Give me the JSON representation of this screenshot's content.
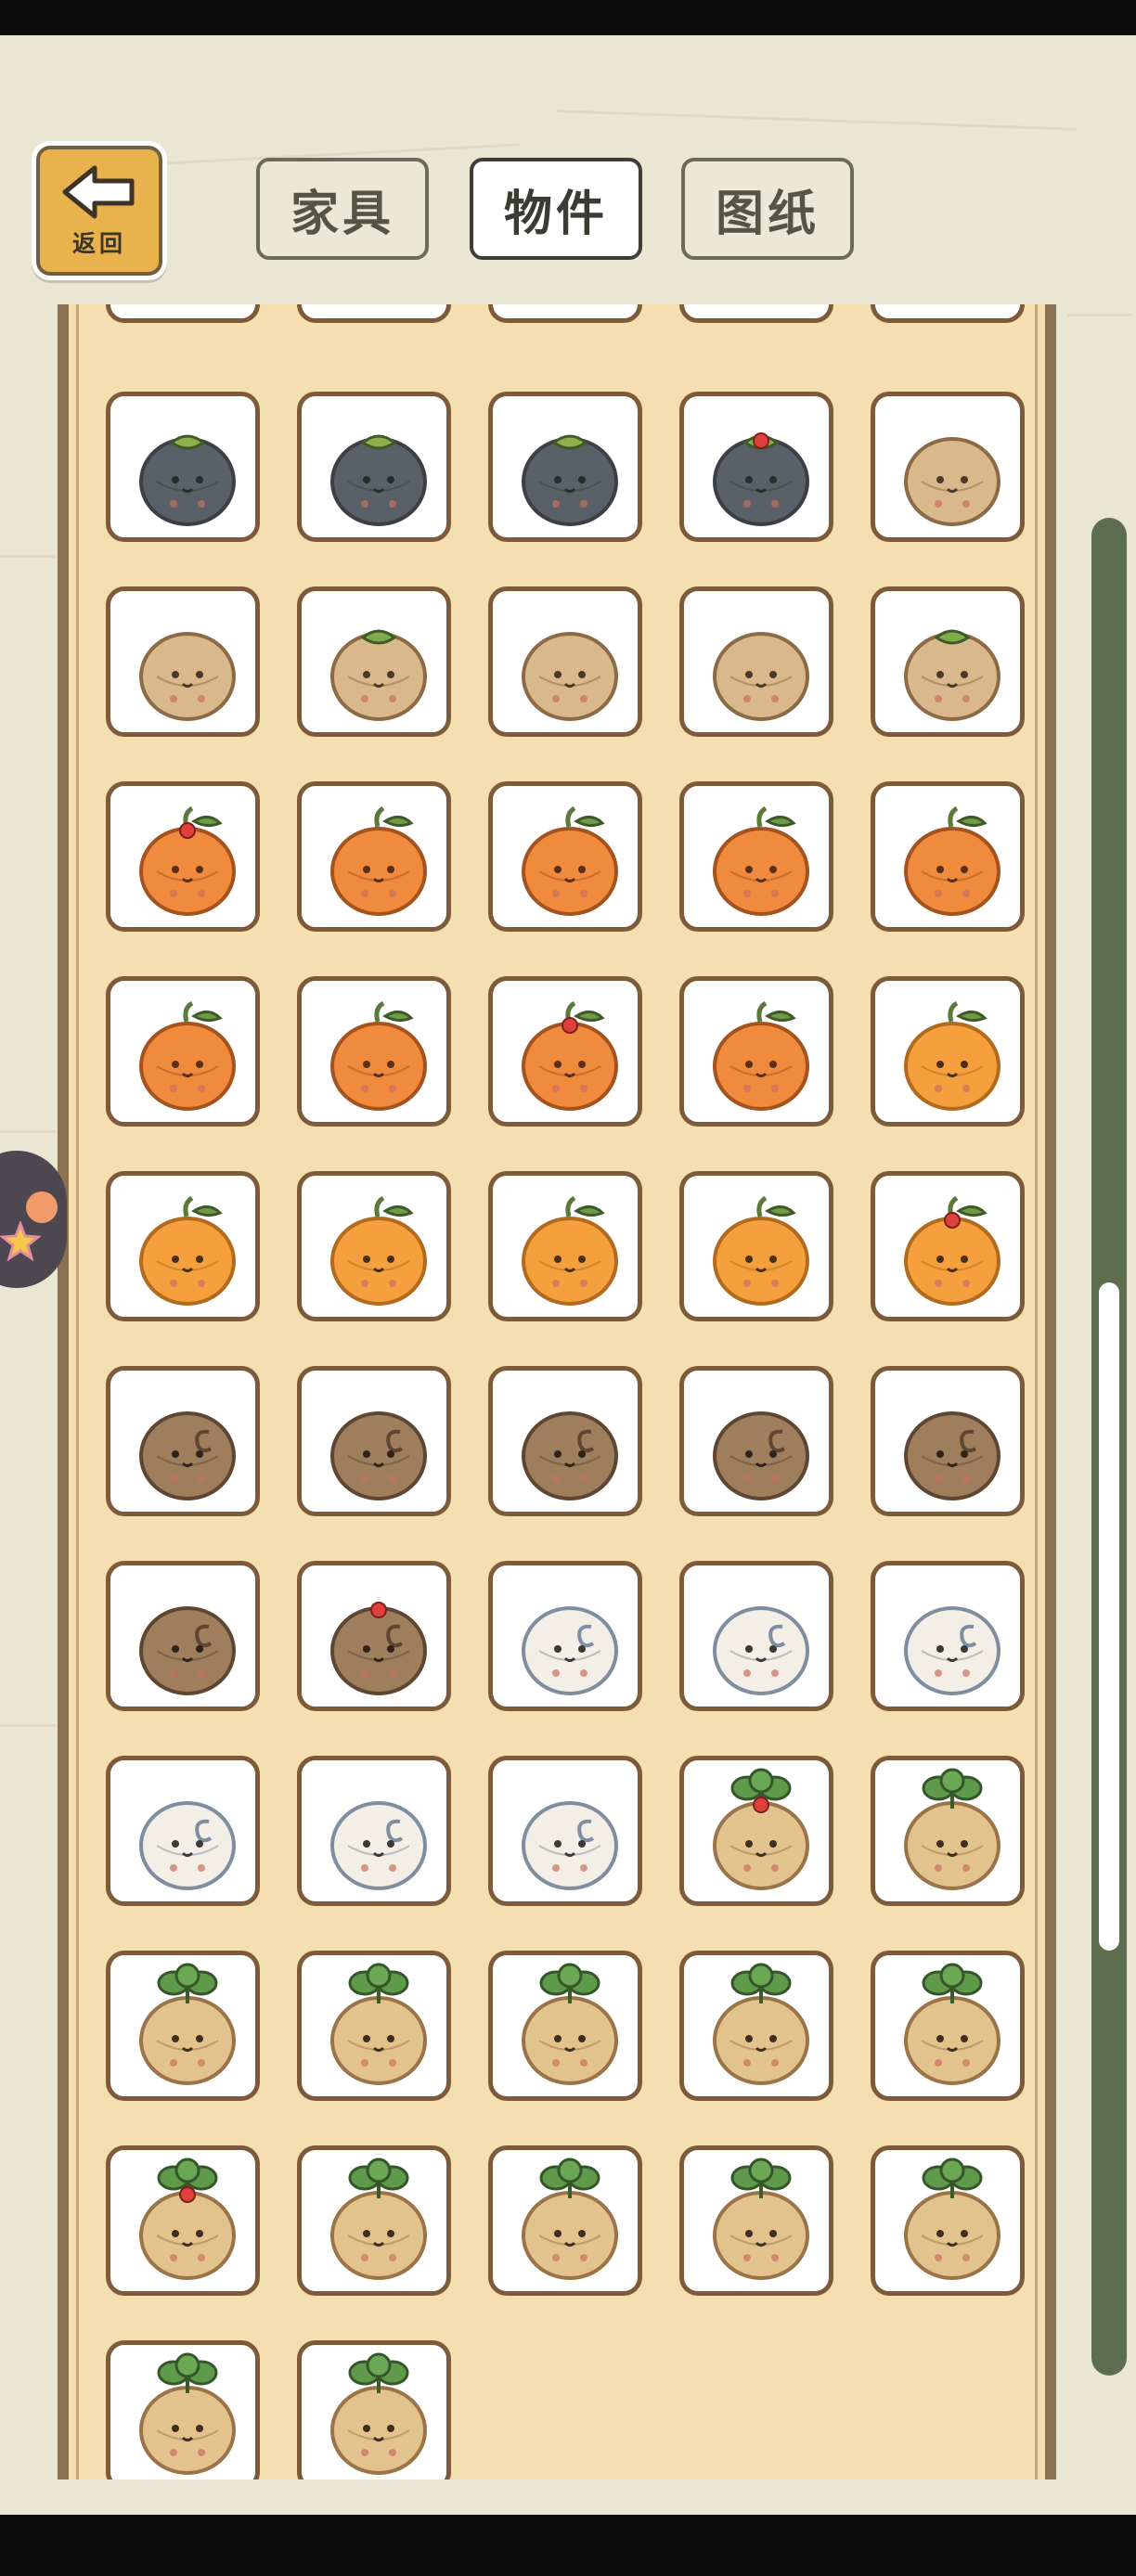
{
  "header": {
    "back_label": "返回",
    "tabs": [
      {
        "label": "家具",
        "active": false
      },
      {
        "label": "物件",
        "active": true
      },
      {
        "label": "图纸",
        "active": false
      }
    ]
  },
  "colors": {
    "panel": "#f5deb0",
    "cell_border": "#7d5a3a",
    "scrollbar_track": "#5d6e4f"
  },
  "grid": {
    "items": [
      {
        "type": "gray"
      },
      {
        "type": "gray"
      },
      {
        "type": "gray"
      },
      {
        "type": "gray"
      },
      {
        "type": "tan"
      },
      {
        "type": "tan"
      },
      {
        "type": "tan"
      },
      {
        "type": "tan"
      },
      {
        "type": "tan"
      },
      {
        "type": "tan"
      },
      {
        "type": "pumpkin"
      },
      {
        "type": "pumpkin"
      },
      {
        "type": "pumpkin"
      },
      {
        "type": "pumpkin"
      },
      {
        "type": "pumpkin"
      },
      {
        "type": "pumpkin"
      },
      {
        "type": "pumpkin"
      },
      {
        "type": "pumpkin"
      },
      {
        "type": "pumpkin"
      },
      {
        "type": "orange"
      },
      {
        "type": "orange"
      },
      {
        "type": "orange"
      },
      {
        "type": "orange"
      },
      {
        "type": "orange"
      },
      {
        "type": "orange"
      },
      {
        "type": "snail"
      },
      {
        "type": "snail"
      },
      {
        "type": "snail"
      },
      {
        "type": "snail"
      },
      {
        "type": "snail"
      },
      {
        "type": "snail"
      },
      {
        "type": "snail"
      },
      {
        "type": "snail-white"
      },
      {
        "type": "snail-white"
      },
      {
        "type": "snail-white"
      },
      {
        "type": "snail-white"
      },
      {
        "type": "snail-white"
      },
      {
        "type": "snail-white"
      },
      {
        "type": "sprout"
      },
      {
        "type": "sprout"
      },
      {
        "type": "sprout"
      },
      {
        "type": "sprout"
      },
      {
        "type": "sprout"
      },
      {
        "type": "sprout"
      },
      {
        "type": "sprout"
      },
      {
        "type": "sprout"
      },
      {
        "type": "sprout"
      },
      {
        "type": "sprout"
      },
      {
        "type": "sprout"
      },
      {
        "type": "sprout"
      },
      {
        "type": "sprout"
      },
      {
        "type": "sprout"
      }
    ]
  }
}
